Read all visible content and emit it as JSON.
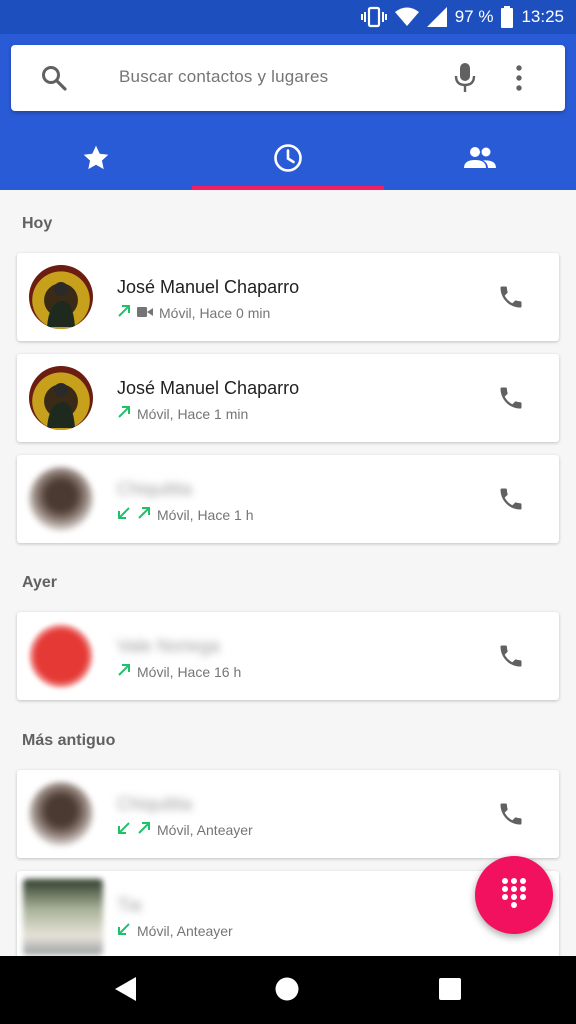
{
  "status_bar": {
    "battery": "97 %",
    "time": "13:25"
  },
  "search": {
    "placeholder": "Buscar contactos y lugares"
  },
  "tabs": [
    {
      "icon": "star-icon"
    },
    {
      "icon": "clock-icon",
      "active": true
    },
    {
      "icon": "people-icon"
    }
  ],
  "sections": {
    "today": "Hoy",
    "yesterday": "Ayer",
    "older": "Más antiguo"
  },
  "calls": [
    {
      "name": "José Manuel Chaparro",
      "detail": "Móvil, Hace 0 min",
      "arrows": [
        "outgoing"
      ],
      "video": true
    },
    {
      "name": "José Manuel Chaparro",
      "detail": "Móvil, Hace 1 min",
      "arrows": [
        "outgoing"
      ],
      "video": false
    },
    {
      "name": "Chiquitita",
      "detail": "Móvil, Hace 1 h",
      "arrows": [
        "incoming",
        "outgoing"
      ],
      "video": false
    },
    {
      "name": "Vale Noriega",
      "detail": "Móvil, Hace 16 h",
      "arrows": [
        "outgoing"
      ],
      "video": false
    },
    {
      "name": "Chiquitita",
      "detail": "Móvil, Anteayer",
      "arrows": [
        "incoming",
        "outgoing"
      ],
      "video": false
    },
    {
      "name": "Tia",
      "detail": "Móvil, Anteayer",
      "arrows": [
        "incoming"
      ],
      "video": false
    }
  ],
  "colors": {
    "status_bar": "#1e4fbf",
    "app_bar": "#2a5bd7",
    "accent": "#f41f63",
    "call_arrow": "#21c16b"
  }
}
